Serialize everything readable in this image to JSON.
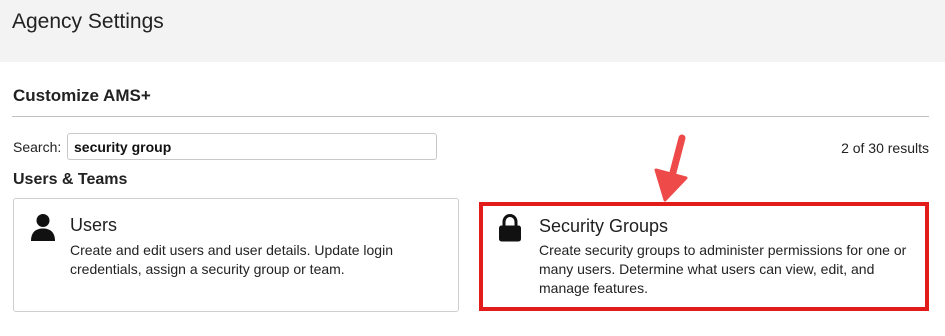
{
  "header": {
    "title": "Agency Settings"
  },
  "section": {
    "title": "Customize AMS+"
  },
  "search": {
    "label": "Search:",
    "value": "security group",
    "results": "2 of 30 results"
  },
  "group": {
    "title": "Users & Teams",
    "cards": [
      {
        "icon": "user-icon",
        "title": "Users",
        "desc_lines": [
          "Create and edit users and user details. Update login",
          "credentials, assign a security group or team."
        ]
      },
      {
        "icon": "lock-icon",
        "title": "Security Groups",
        "desc_lines": [
          "Create security groups to administer permissions for one or",
          "many users. Determine what users can view, edit, and",
          "manage features."
        ]
      }
    ]
  },
  "annotation": {
    "highlight_color": "#e21b1b",
    "arrow_color": "#ef4a4a"
  }
}
